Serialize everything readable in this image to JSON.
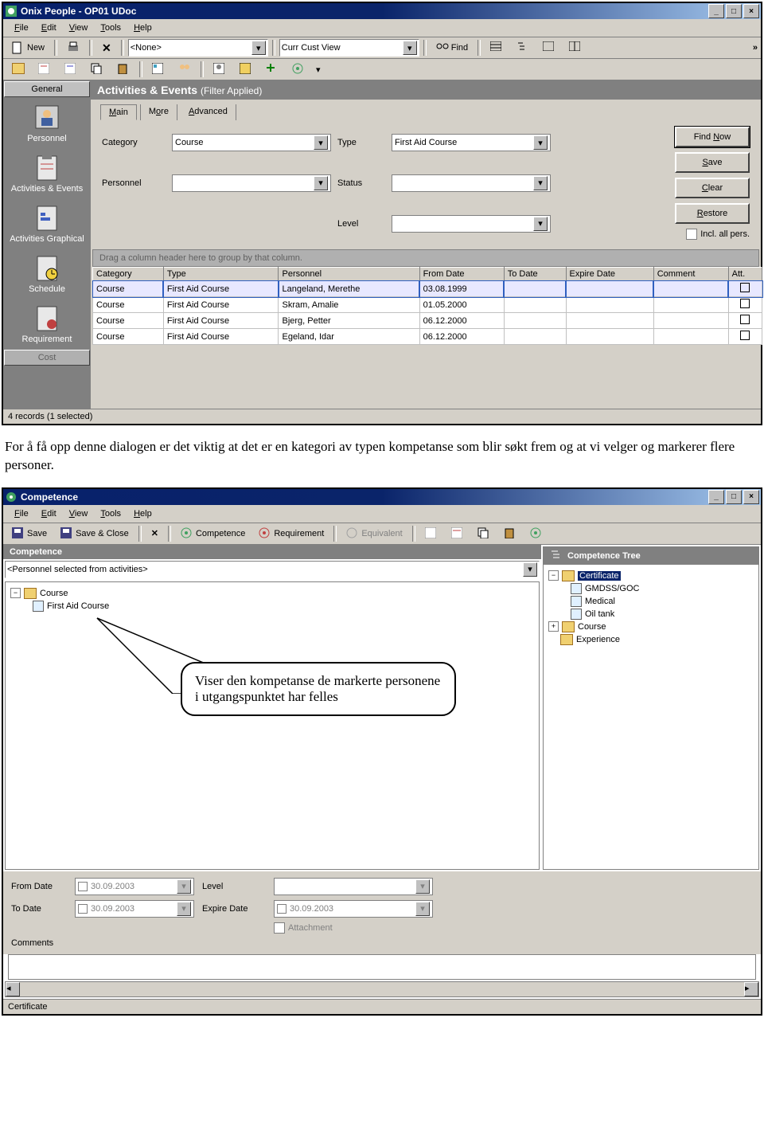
{
  "win1": {
    "title": "Onix People - OP01 UDoc",
    "menu": [
      "File",
      "Edit",
      "View",
      "Tools",
      "Help"
    ],
    "toolbar": {
      "new": "New",
      "find": "Find",
      "combo1": "<None>",
      "combo2": "Curr Cust View"
    },
    "sidenav": {
      "header": "General",
      "items": [
        "Personnel",
        "Activities & Events",
        "Activities Graphical",
        "Schedule",
        "Requirement"
      ],
      "footer": "Cost"
    },
    "panel": {
      "title": "Activities & Events",
      "subtitle": "(Filter Applied)"
    },
    "tabs": [
      "Main",
      "More",
      "Advanced"
    ],
    "filter": {
      "category_lbl": "Category",
      "category_val": "Course",
      "type_lbl": "Type",
      "type_val": "First Aid Course",
      "personnel_lbl": "Personnel",
      "personnel_val": "",
      "status_lbl": "Status",
      "status_val": "",
      "level_lbl": "Level",
      "level_val": ""
    },
    "buttons": {
      "find": "Find Now",
      "save": "Save",
      "clear": "Clear",
      "restore": "Restore",
      "incl": "Incl. all pers."
    },
    "grouphint": "Drag a column header here to group by that column.",
    "cols": [
      "Category",
      "Type",
      "Personnel",
      "From Date",
      "To Date",
      "Expire Date",
      "Comment",
      "Att."
    ],
    "rows": [
      {
        "cat": "Course",
        "type": "First Aid Course",
        "pers": "Langeland, Merethe",
        "from": "03.08.1999"
      },
      {
        "cat": "Course",
        "type": "First Aid Course",
        "pers": "Skram, Amalie",
        "from": "01.05.2000"
      },
      {
        "cat": "Course",
        "type": "First Aid Course",
        "pers": "Bjerg, Petter",
        "from": "06.12.2000"
      },
      {
        "cat": "Course",
        "type": "First Aid Course",
        "pers": "Egeland, Idar",
        "from": "06.12.2000"
      }
    ],
    "status": "4 records (1 selected)"
  },
  "doctext": "For å få opp denne dialogen er det viktig at det er en kategori av typen kompetanse som blir søkt frem og at vi velger og markerer flere personer.",
  "win2": {
    "title": "Competence",
    "menu": [
      "File",
      "Edit",
      "View",
      "Tools",
      "Help"
    ],
    "toolbar": {
      "save": "Save",
      "saveclose": "Save & Close",
      "competence": "Competence",
      "requirement": "Requirement",
      "equivalent": "Equivalent"
    },
    "leftheader": "Competence",
    "rightheader": "Competence Tree",
    "combo": "<Personnel selected from activities>",
    "lefttree": {
      "l1": "Course",
      "l2": "First Aid Course"
    },
    "righttree": {
      "r1": "Certificate",
      "r1a": "GMDSS/GOC",
      "r1b": "Medical",
      "r1c": "Oil tank",
      "r2": "Course",
      "r3": "Experience"
    },
    "callout": "Viser den kompetanse de markerte personene i utgangspunktet har felles",
    "form": {
      "fromdate_lbl": "From Date",
      "fromdate_val": "30.09.2003",
      "todate_lbl": "To Date",
      "todate_val": "30.09.2003",
      "level_lbl": "Level",
      "expire_lbl": "Expire Date",
      "expire_val": "30.09.2003",
      "attach_lbl": "Attachment",
      "comments_lbl": "Comments"
    },
    "status": "Certificate"
  }
}
